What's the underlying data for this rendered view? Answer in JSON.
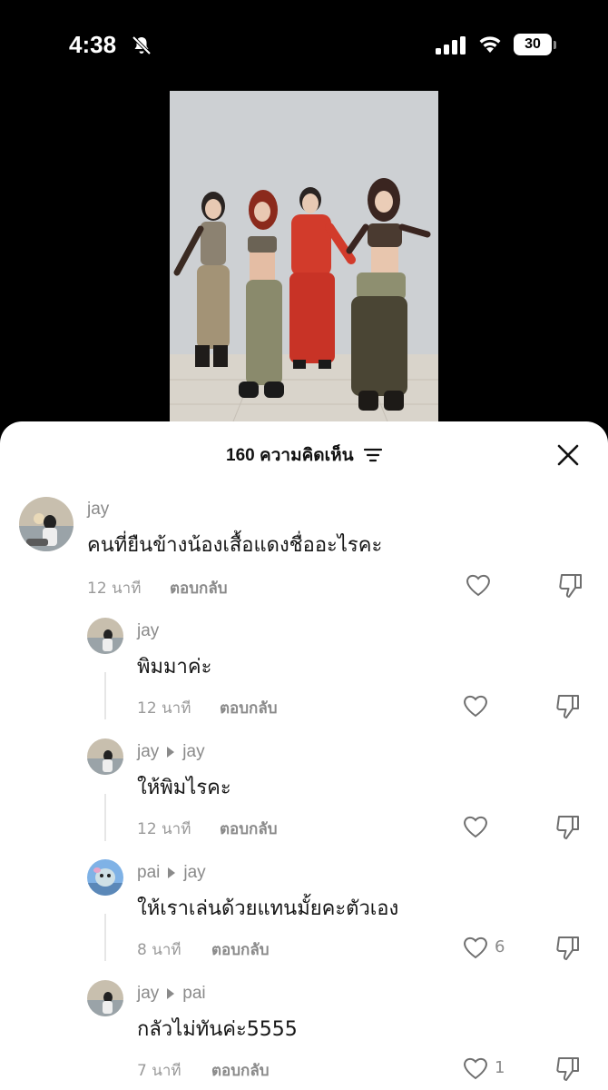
{
  "status_bar": {
    "time": "4:38",
    "battery": "30"
  },
  "sheet": {
    "count_label": "160 ความคิดเห็น"
  },
  "comments": [
    {
      "username": "jay",
      "reply_to": "",
      "text": "คนที่ยืนข้างน้องเสื้อแดงชื่ออะไรคะ",
      "time": "12 นาที",
      "reply_label": "ตอบกลับ",
      "likes": ""
    },
    {
      "username": "jay",
      "reply_to": "",
      "text": "พิมมาค่ะ",
      "time": "12 นาที",
      "reply_label": "ตอบกลับ",
      "likes": ""
    },
    {
      "username": "jay",
      "reply_to": "jay",
      "text": "ให้พิมไรคะ",
      "time": "12 นาที",
      "reply_label": "ตอบกลับ",
      "likes": ""
    },
    {
      "username": "pai",
      "reply_to": "jay",
      "text": "ให้เราเล่นด้วยแทนมั้ยคะตัวเอง",
      "time": "8 นาที",
      "reply_label": "ตอบกลับ",
      "likes": "6"
    },
    {
      "username": "jay",
      "reply_to": "pai",
      "text": "กลัวไม่ทันค่ะ5555",
      "time": "7 นาที",
      "reply_label": "ตอบกลับ",
      "likes": "1"
    }
  ]
}
